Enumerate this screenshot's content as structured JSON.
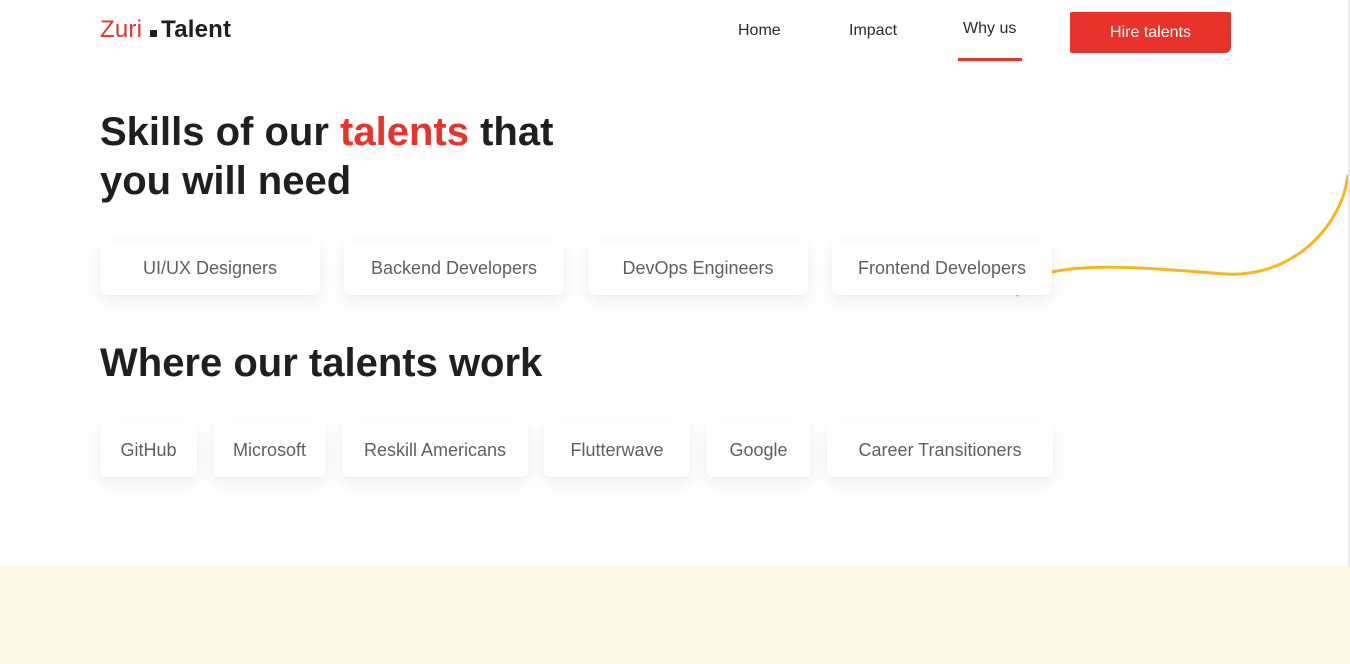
{
  "header": {
    "logo": {
      "part1": "Zuri",
      "part2": "Talent"
    },
    "nav": [
      {
        "label": "Home"
      },
      {
        "label": "Impact"
      },
      {
        "label": "Why us",
        "active": true
      }
    ],
    "cta": "Hire talents"
  },
  "skills_section": {
    "heading_before": "Skills of our ",
    "heading_accent": "talents",
    "heading_after": " that you will need",
    "items": [
      "UI/UX Designers",
      "Backend Developers",
      "DevOps Engineers",
      "Frontend Developers"
    ]
  },
  "work_section": {
    "heading": "Where our talents work",
    "items": [
      "GitHub",
      "Microsoft",
      "Reskill Americans",
      "Flutterwave",
      "Google",
      "Career Transitioners"
    ]
  },
  "colors": {
    "accent": "#e8322b",
    "squiggle": "#f5b91b",
    "cream": "#fef7e4"
  }
}
